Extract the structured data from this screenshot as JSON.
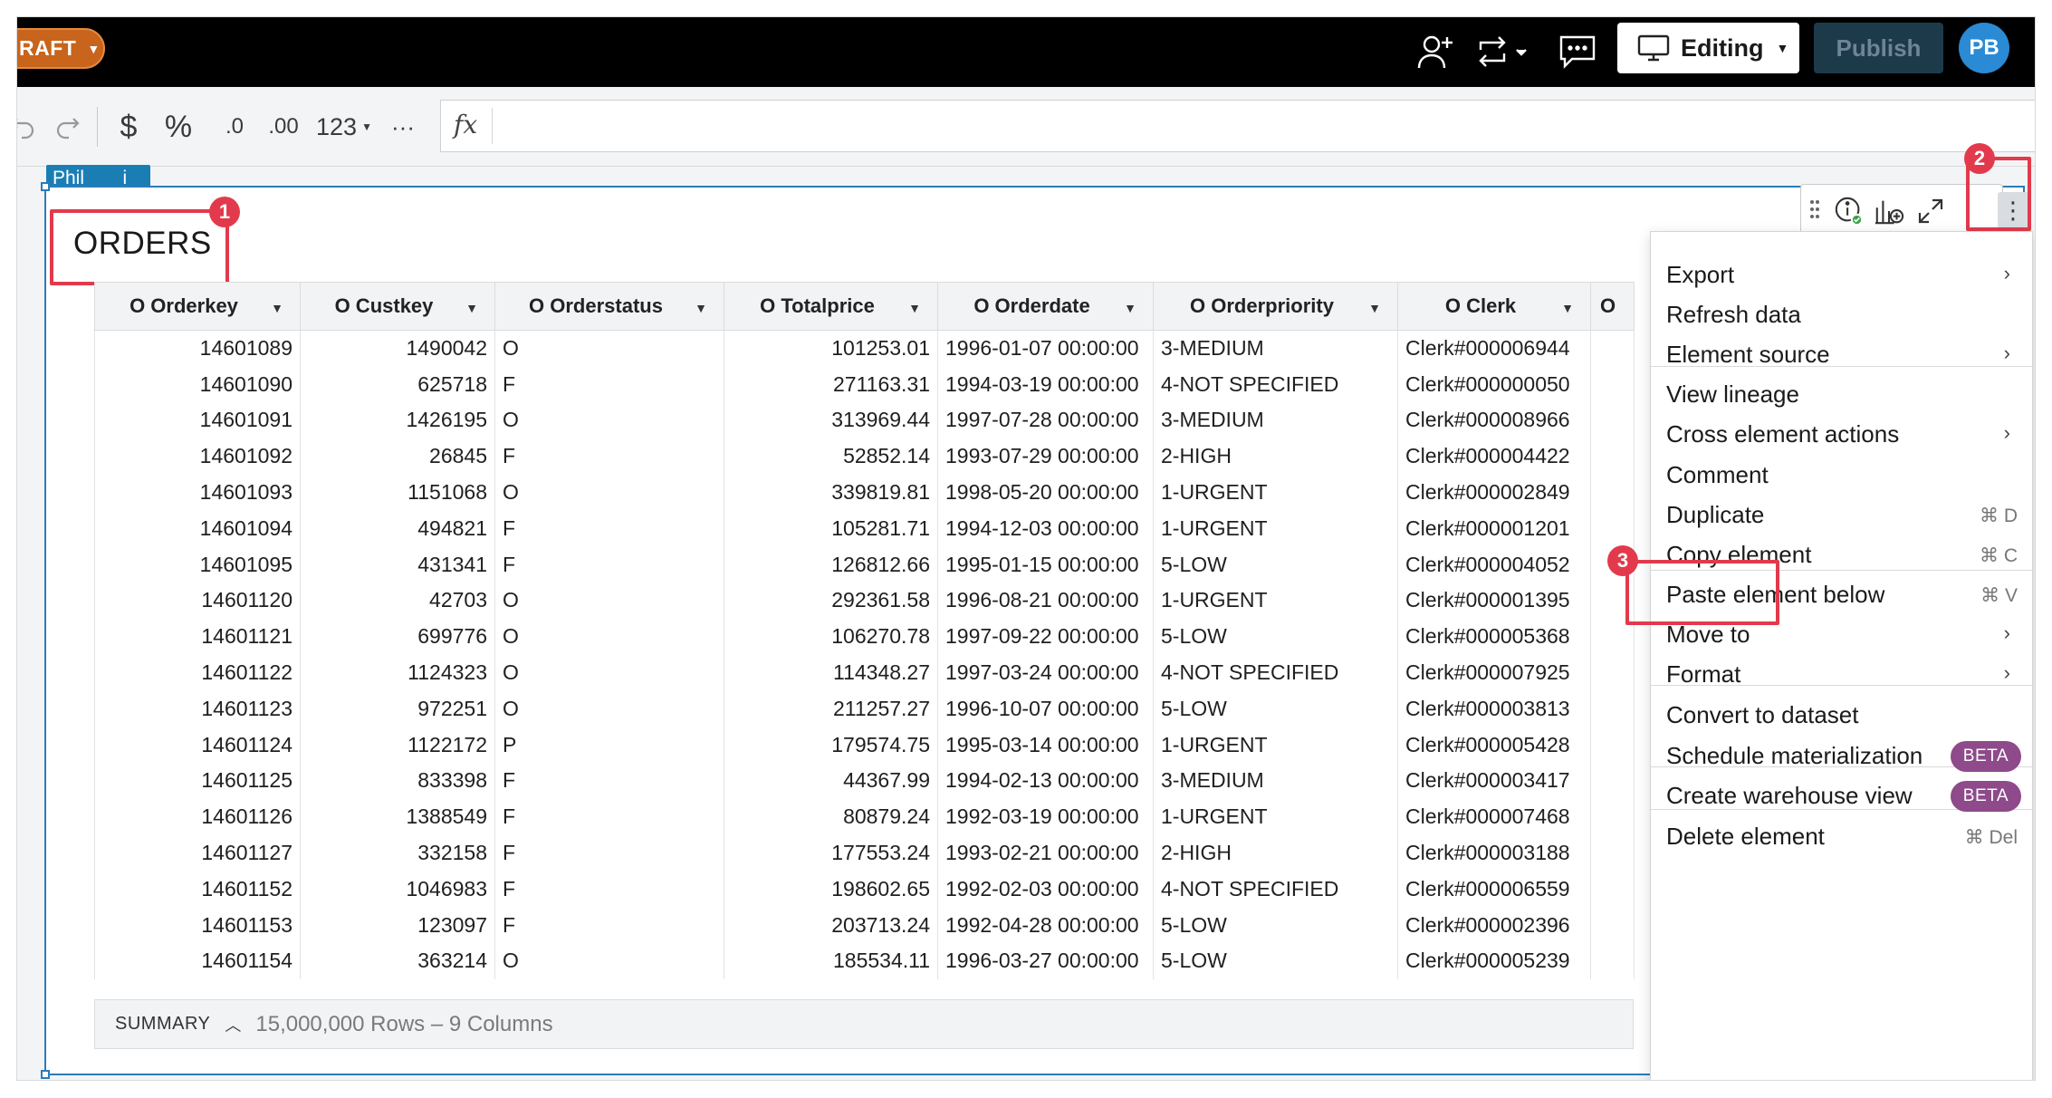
{
  "topbar": {
    "draft_label": "RAFT",
    "editing_label": "Editing",
    "publish_label": "Publish",
    "avatar_initials": "PB"
  },
  "format_toolbar": {
    "currency": "$",
    "percent": "%",
    "decrease_decimals": ".0",
    "increase_decimals": ".00",
    "number_format": "123",
    "more": "···",
    "fx": "fx"
  },
  "element": {
    "tag": "Phil ⠀⠀ i",
    "title": "ORDERS"
  },
  "table": {
    "columns": [
      "O Orderkey",
      "O Custkey",
      "O Orderstatus",
      "O Totalprice",
      "O Orderdate",
      "O Orderpriority",
      "O Clerk",
      "O"
    ],
    "rows": [
      [
        "14601089",
        "1490042",
        "O",
        "101253.01",
        "1996-01-07 00:00:00",
        "3-MEDIUM",
        "Clerk#000006944"
      ],
      [
        "14601090",
        "625718",
        "F",
        "271163.31",
        "1994-03-19 00:00:00",
        "4-NOT SPECIFIED",
        "Clerk#000000050"
      ],
      [
        "14601091",
        "1426195",
        "O",
        "313969.44",
        "1997-07-28 00:00:00",
        "3-MEDIUM",
        "Clerk#000008966"
      ],
      [
        "14601092",
        "26845",
        "F",
        "52852.14",
        "1993-07-29 00:00:00",
        "2-HIGH",
        "Clerk#000004422"
      ],
      [
        "14601093",
        "1151068",
        "O",
        "339819.81",
        "1998-05-20 00:00:00",
        "1-URGENT",
        "Clerk#000002849"
      ],
      [
        "14601094",
        "494821",
        "F",
        "105281.71",
        "1994-12-03 00:00:00",
        "1-URGENT",
        "Clerk#000001201"
      ],
      [
        "14601095",
        "431341",
        "F",
        "126812.66",
        "1995-01-15 00:00:00",
        "5-LOW",
        "Clerk#000004052"
      ],
      [
        "14601120",
        "42703",
        "O",
        "292361.58",
        "1996-08-21 00:00:00",
        "1-URGENT",
        "Clerk#000001395"
      ],
      [
        "14601121",
        "699776",
        "O",
        "106270.78",
        "1997-09-22 00:00:00",
        "5-LOW",
        "Clerk#000005368"
      ],
      [
        "14601122",
        "1124323",
        "O",
        "114348.27",
        "1997-03-24 00:00:00",
        "4-NOT SPECIFIED",
        "Clerk#000007925"
      ],
      [
        "14601123",
        "972251",
        "O",
        "211257.27",
        "1996-10-07 00:00:00",
        "5-LOW",
        "Clerk#000003813"
      ],
      [
        "14601124",
        "1122172",
        "P",
        "179574.75",
        "1995-03-14 00:00:00",
        "1-URGENT",
        "Clerk#000005428"
      ],
      [
        "14601125",
        "833398",
        "F",
        "44367.99",
        "1994-02-13 00:00:00",
        "3-MEDIUM",
        "Clerk#000003417"
      ],
      [
        "14601126",
        "1388549",
        "F",
        "80879.24",
        "1992-03-19 00:00:00",
        "1-URGENT",
        "Clerk#000007468"
      ],
      [
        "14601127",
        "332158",
        "F",
        "177553.24",
        "1993-02-21 00:00:00",
        "2-HIGH",
        "Clerk#000003188"
      ],
      [
        "14601152",
        "1046983",
        "F",
        "198602.65",
        "1992-02-03 00:00:00",
        "4-NOT SPECIFIED",
        "Clerk#000006559"
      ],
      [
        "14601153",
        "123097",
        "F",
        "203713.24",
        "1992-04-28 00:00:00",
        "5-LOW",
        "Clerk#000002396"
      ],
      [
        "14601154",
        "363214",
        "O",
        "185534.11",
        "1996-03-27 00:00:00",
        "5-LOW",
        "Clerk#000005239"
      ]
    ]
  },
  "summary": {
    "label": "SUMMARY",
    "count_text": "15,000,000 Rows – 9 Columns"
  },
  "menu": {
    "items": [
      {
        "label": "Export",
        "chevron": true
      },
      {
        "label": "Refresh data"
      },
      {
        "label": "Element source",
        "chevron": true
      },
      {
        "label": "View lineage"
      },
      {
        "label": "Cross element actions",
        "chevron": true
      },
      {
        "label": "Comment"
      },
      {
        "label": "Duplicate",
        "shortcut": "⌘ D"
      },
      {
        "label": "Copy element",
        "shortcut": "⌘ C"
      },
      {
        "label": "Paste element below",
        "shortcut": "⌘ V"
      },
      {
        "label": "Move to",
        "chevron": true
      },
      {
        "label": "Format",
        "chevron": true
      },
      {
        "label": "Convert to dataset"
      },
      {
        "label": "Schedule materialization",
        "badge": "BETA"
      },
      {
        "label": "Create warehouse view",
        "badge": "BETA"
      },
      {
        "label": "Delete element",
        "shortcut": "⌘ Del"
      }
    ]
  },
  "annotations": [
    "1",
    "2",
    "3"
  ],
  "colors": {
    "accent_blue": "#2b7cb8",
    "highlight_red": "#e23a4c",
    "draft_orange": "#c8641c",
    "beta_purple": "#8e4a8a"
  }
}
